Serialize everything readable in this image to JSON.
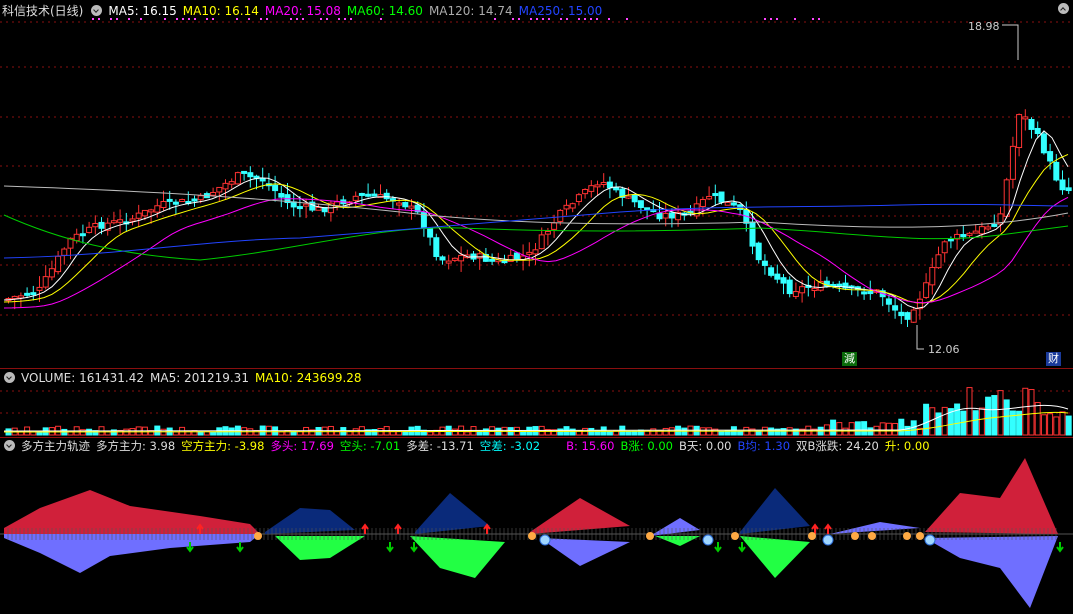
{
  "main": {
    "title": "科信技术(日线)",
    "ma": [
      {
        "label": "MA5: 16.15",
        "color": "#ffffff"
      },
      {
        "label": "MA10: 16.14",
        "color": "#ffff00"
      },
      {
        "label": "MA20: 15.08",
        "color": "#ff00ff"
      },
      {
        "label": "MA60: 14.60",
        "color": "#00ff00"
      },
      {
        "label": "MA120: 14.74",
        "color": "#aaaaaa"
      },
      {
        "label": "MA250: 15.00",
        "color": "#2244ff"
      }
    ],
    "high_label": "18.98",
    "low_label": "12.06",
    "marker_jian": "減",
    "marker_cai": "财"
  },
  "volume": {
    "items": [
      {
        "label": "VOLUME: 161431.42",
        "color": "#dddddd"
      },
      {
        "label": "MA5: 201219.31",
        "color": "#dddddd"
      },
      {
        "label": "MA10: 243699.28",
        "color": "#ffff00"
      }
    ]
  },
  "indicator": {
    "items": [
      {
        "label": "多方主力轨迹",
        "color": "#dddddd"
      },
      {
        "label": "多方主力: 3.98",
        "color": "#dddddd"
      },
      {
        "label": "空方主力: -3.98",
        "color": "#ffff00"
      },
      {
        "label": "多头: 17.69",
        "color": "#ff00ff"
      },
      {
        "label": "空头: -7.01",
        "color": "#00ff00"
      },
      {
        "label": "多差: -13.71",
        "color": "#dddddd"
      },
      {
        "label": "空差: -3.02",
        "color": "#00ffff"
      },
      {
        "label": "B: 15.60",
        "color": "#ff00ff"
      },
      {
        "label": "B涨: 0.00",
        "color": "#00ff00"
      },
      {
        "label": "B天: 0.00",
        "color": "#dddddd"
      },
      {
        "label": "B均: 1.30",
        "color": "#2244ff"
      },
      {
        "label": "双B涨跌: 24.20",
        "color": "#dddddd"
      },
      {
        "label": "升: 0.00",
        "color": "#ffff00"
      }
    ]
  },
  "colors": {
    "up": "#ff3333",
    "down": "#33ffff",
    "grid": "#8a0f0f"
  }
}
